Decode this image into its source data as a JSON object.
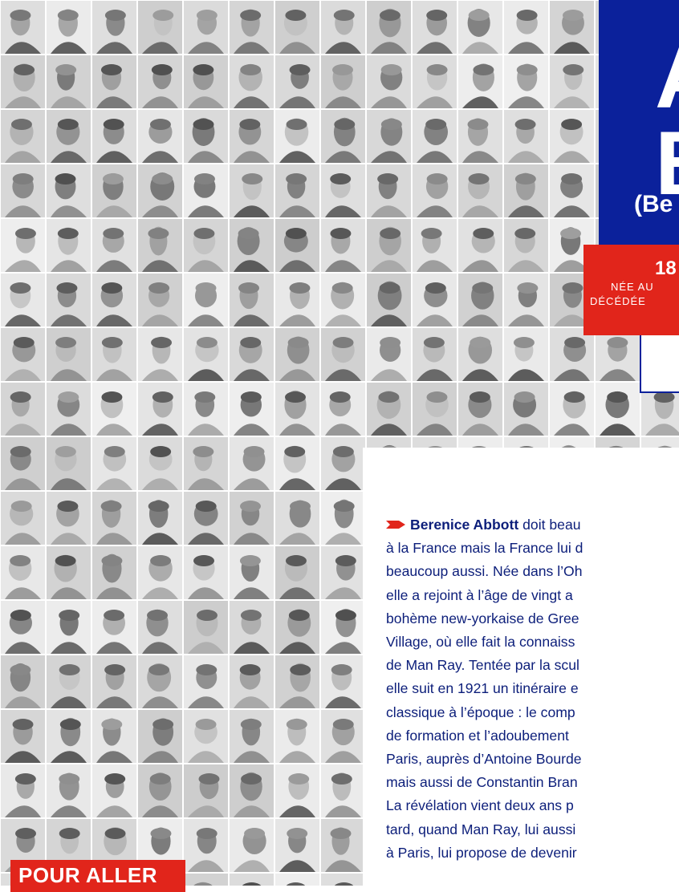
{
  "title": {
    "first_name": "A",
    "last_name": "B",
    "paren": "(Be"
  },
  "dates": {
    "years": "18",
    "born": "NÉE AU",
    "died": "DÉCÉDÉE"
  },
  "body": {
    "lead_name": "Berenice Abbott",
    "lines": [
      "doit beau",
      "à la France mais la France lui d",
      "beaucoup aussi. Née dans l’Oh",
      "elle a rejoint à l’âge de vingt a",
      "bohème new-yorkaise de Gree",
      "Village, où elle fait la connaiss",
      "de Man Ray. Tentée par la scul",
      "elle suit en 1921 un itinéraire e",
      "classique à l’époque : le comp",
      "de formation et l’adoubement",
      "Paris, auprès d’Antoine Bourde",
      "mais aussi de Constantin Bran",
      "La révélation vient deux ans p",
      "tard, quand Man Ray, lui aussi",
      "à Paris, lui propose de devenir"
    ]
  },
  "tab": {
    "label": "POUR ALLER"
  },
  "colors": {
    "navy": "#0b219b",
    "red": "#e1251b",
    "text": "#0c1e7a"
  },
  "icons": {
    "bullet": "arrow-right-icon"
  }
}
